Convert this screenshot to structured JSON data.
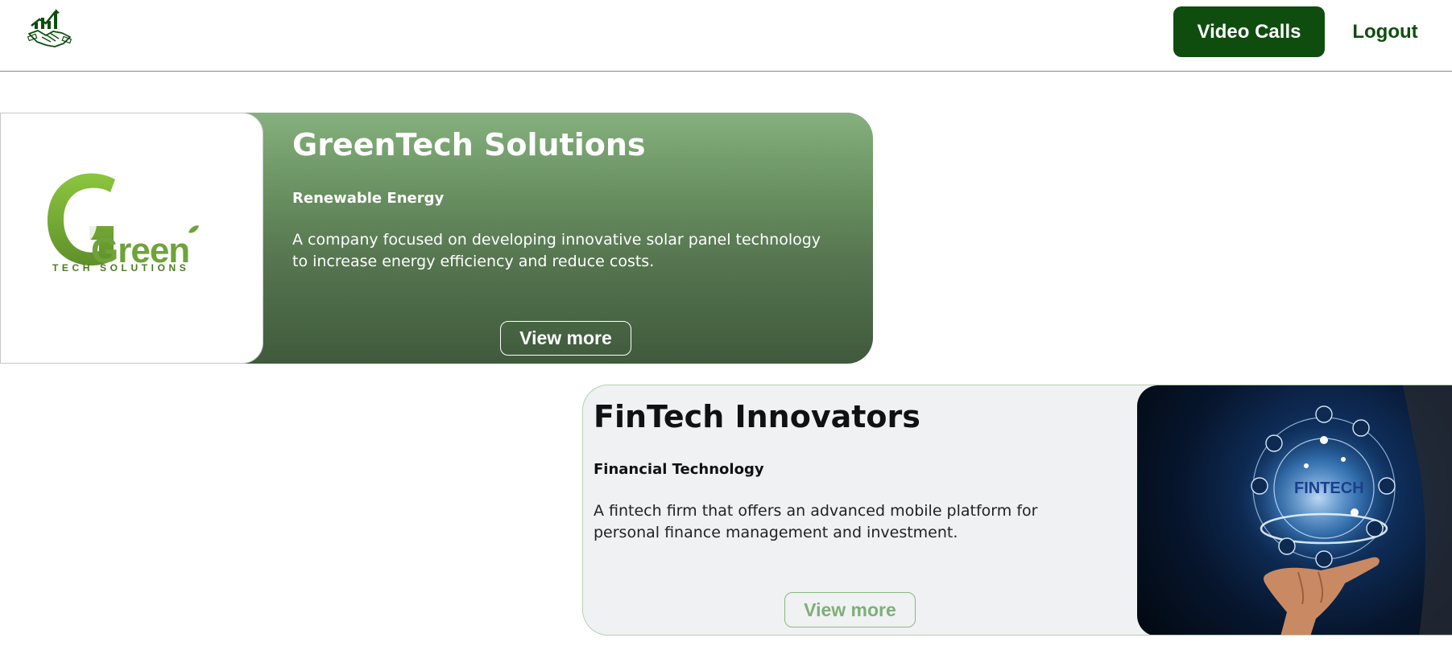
{
  "header": {
    "logo_icon": "handshake-chart-logo",
    "video_calls_label": "Video Calls",
    "logout_label": "Logout"
  },
  "colors": {
    "brand_green": "#0f4d0f",
    "card1_gradient_top": "#86b07e",
    "card1_gradient_bottom": "#3f5a3c",
    "card2_background": "#f0f1f3",
    "card2_button": "#7eaf77"
  },
  "companies": [
    {
      "name": "GreenTech Solutions",
      "industry": "Renewable Energy",
      "description": "A company focused on developing innovative solar panel technology to increase energy efficiency and reduce costs.",
      "view_more_label": "View more",
      "logo_text": "Green",
      "logo_subtext": "TECH SOLUTIONS"
    },
    {
      "name": "FinTech Innovators",
      "industry": "Financial Technology",
      "description": "A fintech firm that offers an advanced mobile platform for personal finance management and investment.",
      "view_more_label": "View more",
      "image_text": "FINTECH"
    }
  ]
}
